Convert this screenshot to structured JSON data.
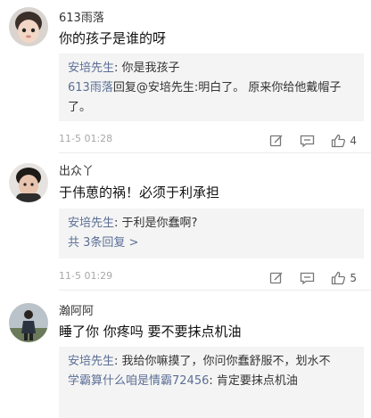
{
  "comments": [
    {
      "username": "613雨落",
      "text": "你的孩子是谁的呀",
      "replies": [
        {
          "author": "安培先生",
          "sep": ": ",
          "text": "你是我孩子"
        },
        {
          "author": "613雨落",
          "sep": "回复",
          "text": "@安培先生:明白了。 原来你给他戴帽子了。"
        }
      ],
      "more": "",
      "time": "11-5 01:28",
      "likes": "4"
    },
    {
      "username": "出众丫",
      "text": "于伟葸的祸！必须于利承担",
      "replies": [
        {
          "author": "安培先生",
          "sep": ": ",
          "text": "于利是你蠢啊?"
        }
      ],
      "more": "共 3条回复 >",
      "time": "11-5 01:29",
      "likes": "5"
    },
    {
      "username": "瀚阿阿",
      "text": "睡了你 你疼吗 要不要抹点机油",
      "replies": [
        {
          "author": "安培先生",
          "sep": ": ",
          "text": "我给你嘛摸了，你问你蠢舒服不，划水不"
        },
        {
          "author": "学霸算什么咱是情霸72456",
          "sep": ": ",
          "text": "肯定要抹点机油"
        }
      ],
      "more": "",
      "time": "",
      "likes": ""
    }
  ],
  "colors": {
    "link": "#5b6f96",
    "reply_bg": "#f4f4f4",
    "meta": "#a8a8a8"
  },
  "icons": [
    "edit-icon",
    "comment-icon",
    "thumbs-up-icon"
  ]
}
